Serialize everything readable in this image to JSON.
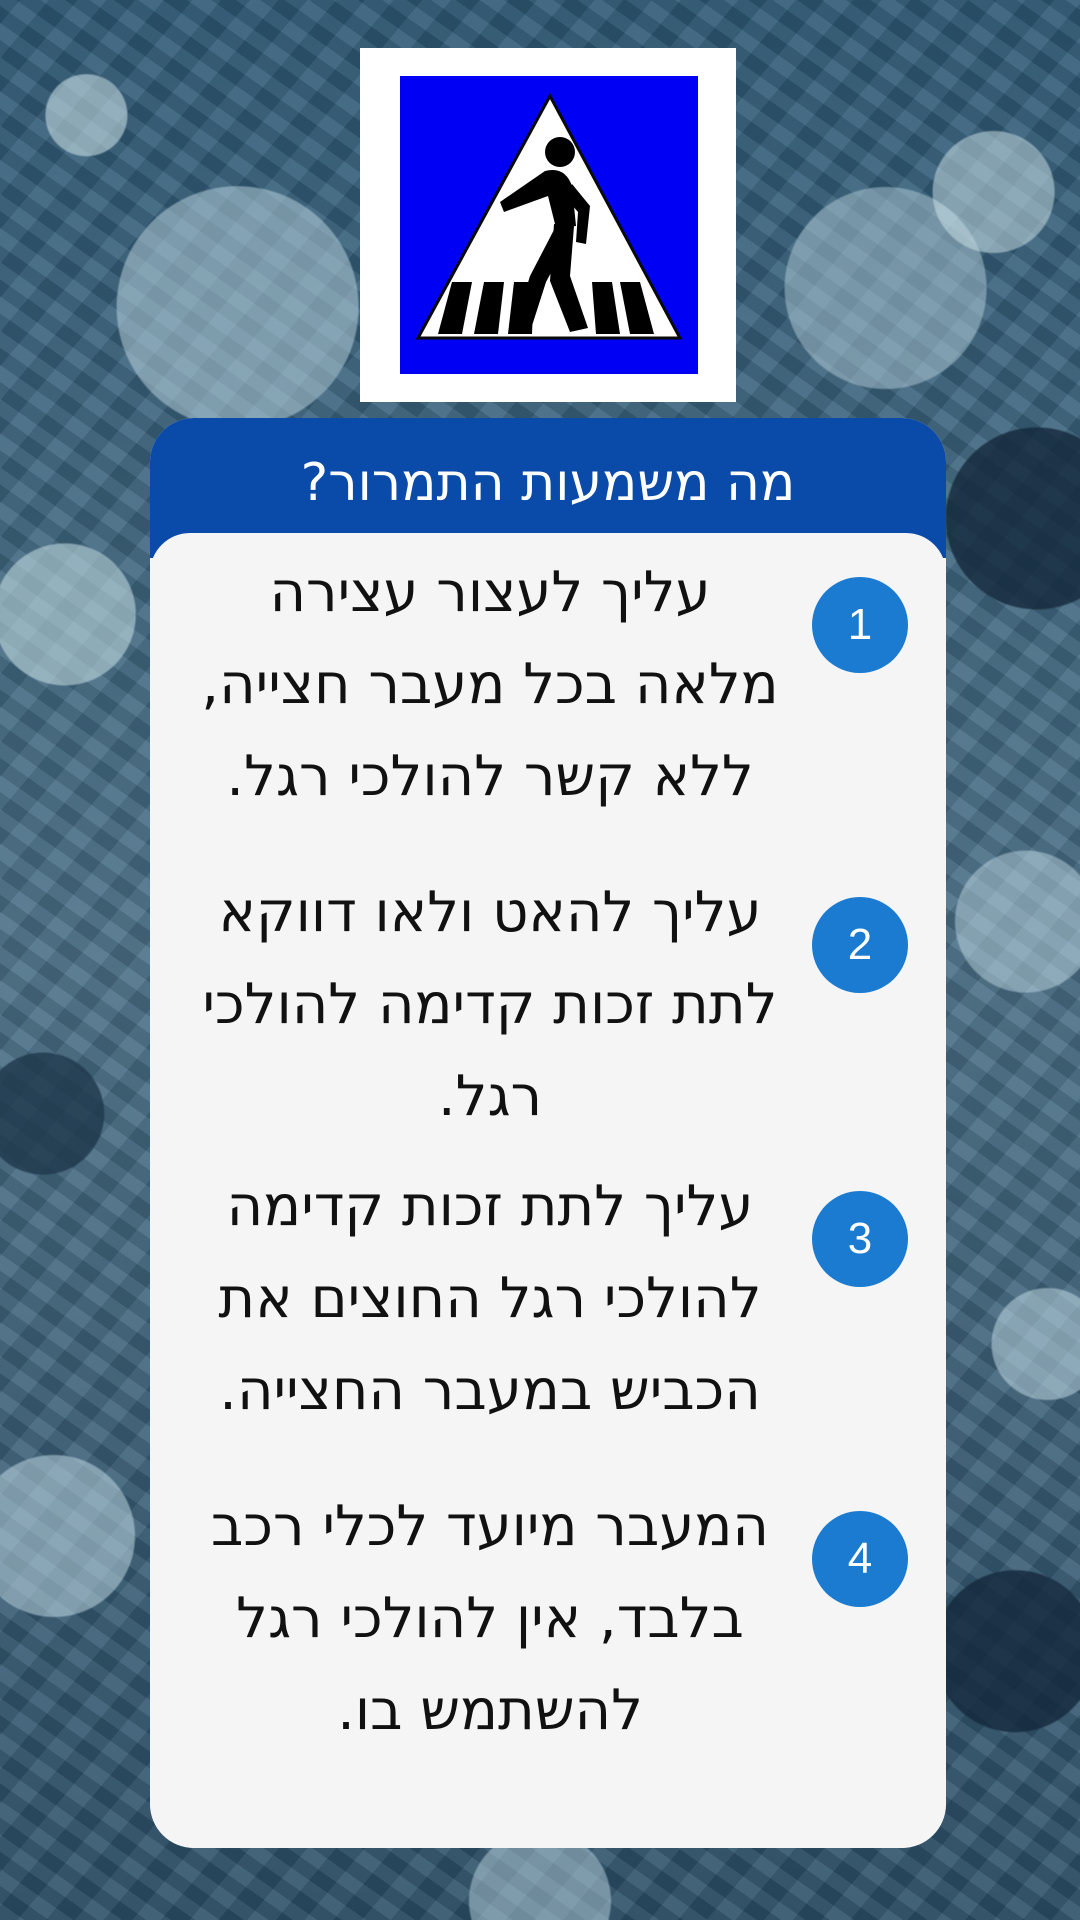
{
  "sign": {
    "icon": "pedestrian-crossing-sign-icon",
    "colors": {
      "background": "#0000f5",
      "triangle": "#ffffff",
      "figure": "#000000"
    }
  },
  "question": {
    "text": "מה משמעות התמרור?",
    "header_color": "#0a4aa8"
  },
  "answers": [
    {
      "number": "1",
      "text": "עליך לעצור עצירה מלאה בכל מעבר חצייה, ללא קשר להולכי רגל."
    },
    {
      "number": "2",
      "text": "עליך להאט ולאו דווקא לתת זכות קדימה להולכי רגל."
    },
    {
      "number": "3",
      "text": "עליך לתת זכות קדימה להולכי רגל החוצים את הכביש במעבר החצייה."
    },
    {
      "number": "4",
      "text": "המעבר מיועד לכלי רכב בלבד, אין להולכי רגל להשתמש בו."
    }
  ],
  "colors": {
    "badge": "#1a7bd1",
    "card": "#f5f5f5"
  }
}
